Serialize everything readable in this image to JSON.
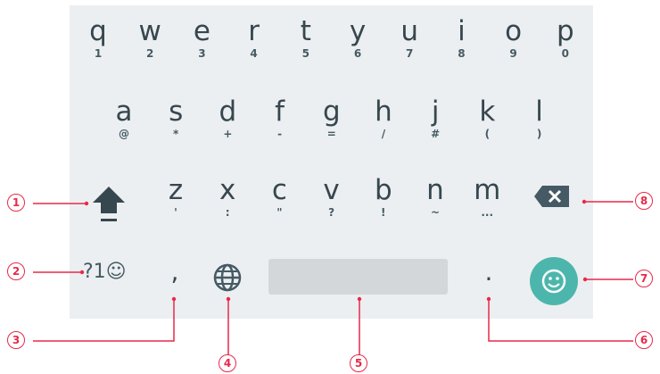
{
  "keyboard": {
    "row1": [
      {
        "key": "q",
        "hint": "1"
      },
      {
        "key": "w",
        "hint": "2"
      },
      {
        "key": "e",
        "hint": "3"
      },
      {
        "key": "r",
        "hint": "4"
      },
      {
        "key": "t",
        "hint": "5"
      },
      {
        "key": "y",
        "hint": "6"
      },
      {
        "key": "u",
        "hint": "7"
      },
      {
        "key": "i",
        "hint": "8"
      },
      {
        "key": "o",
        "hint": "9"
      },
      {
        "key": "p",
        "hint": "0"
      }
    ],
    "row2": [
      {
        "key": "a",
        "hint": "@"
      },
      {
        "key": "s",
        "hint": "*"
      },
      {
        "key": "d",
        "hint": "+"
      },
      {
        "key": "f",
        "hint": "-"
      },
      {
        "key": "g",
        "hint": "="
      },
      {
        "key": "h",
        "hint": "/"
      },
      {
        "key": "j",
        "hint": "#"
      },
      {
        "key": "k",
        "hint": "("
      },
      {
        "key": "l",
        "hint": ")"
      }
    ],
    "row3": [
      {
        "key": "z",
        "hint": "'"
      },
      {
        "key": "x",
        "hint": ":"
      },
      {
        "key": "c",
        "hint": "\""
      },
      {
        "key": "v",
        "hint": "?"
      },
      {
        "key": "b",
        "hint": "!"
      },
      {
        "key": "n",
        "hint": "~"
      },
      {
        "key": "m",
        "hint": "..."
      }
    ],
    "shift_icon": "shift-icon",
    "backspace_icon": "backspace-icon",
    "symbols_label": "?1☺",
    "comma": ",",
    "globe_icon": "globe-icon",
    "period": ".",
    "emoji_icon": "emoji-icon",
    "accent_color": "#4db6ac"
  },
  "callouts": [
    "1",
    "2",
    "3",
    "4",
    "5",
    "6",
    "7",
    "8"
  ],
  "callout_color": "#e8294a"
}
